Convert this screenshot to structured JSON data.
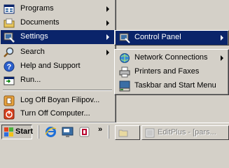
{
  "start_menu": {
    "items": [
      {
        "label": "Programs",
        "icon": "programs-icon",
        "has_submenu": true
      },
      {
        "label": "Documents",
        "icon": "documents-icon",
        "has_submenu": true
      },
      {
        "label": "Settings",
        "icon": "settings-icon",
        "has_submenu": true,
        "selected": true
      },
      {
        "label": "Search",
        "icon": "search-icon",
        "has_submenu": true
      },
      {
        "label": "Help and Support",
        "icon": "help-icon",
        "has_submenu": false
      },
      {
        "label": "Run...",
        "icon": "run-icon",
        "has_submenu": false
      },
      {
        "label": "Log Off Boyan Filipov...",
        "icon": "log-off-icon",
        "has_submenu": false
      },
      {
        "label": "Turn Off Computer...",
        "icon": "turn-off-icon",
        "has_submenu": false
      }
    ]
  },
  "settings_submenu": {
    "items": [
      {
        "label": "Control Panel",
        "icon": "control-panel-icon",
        "has_submenu": true,
        "selected": true
      }
    ]
  },
  "control_panel_submenu": {
    "items": [
      {
        "label": "Network Connections",
        "icon": "network-connections-icon",
        "has_submenu": true
      },
      {
        "label": "Printers and Faxes",
        "icon": "printers-icon",
        "has_submenu": false
      },
      {
        "label": "Taskbar and Start Menu",
        "icon": "taskbar-icon",
        "has_submenu": false
      }
    ]
  },
  "taskbar": {
    "start_label": "Start",
    "quick_launch": [
      "internet-explorer-icon",
      "show-desktop-icon",
      "media-icon"
    ],
    "chevron": "»",
    "windows": [
      {
        "label": "",
        "icon": "folder-icon"
      },
      {
        "label": "EditPlus - [pars...",
        "icon": "editplus-icon"
      }
    ]
  },
  "colors": {
    "selection": "#0a246a",
    "face": "#d4d0c8"
  }
}
